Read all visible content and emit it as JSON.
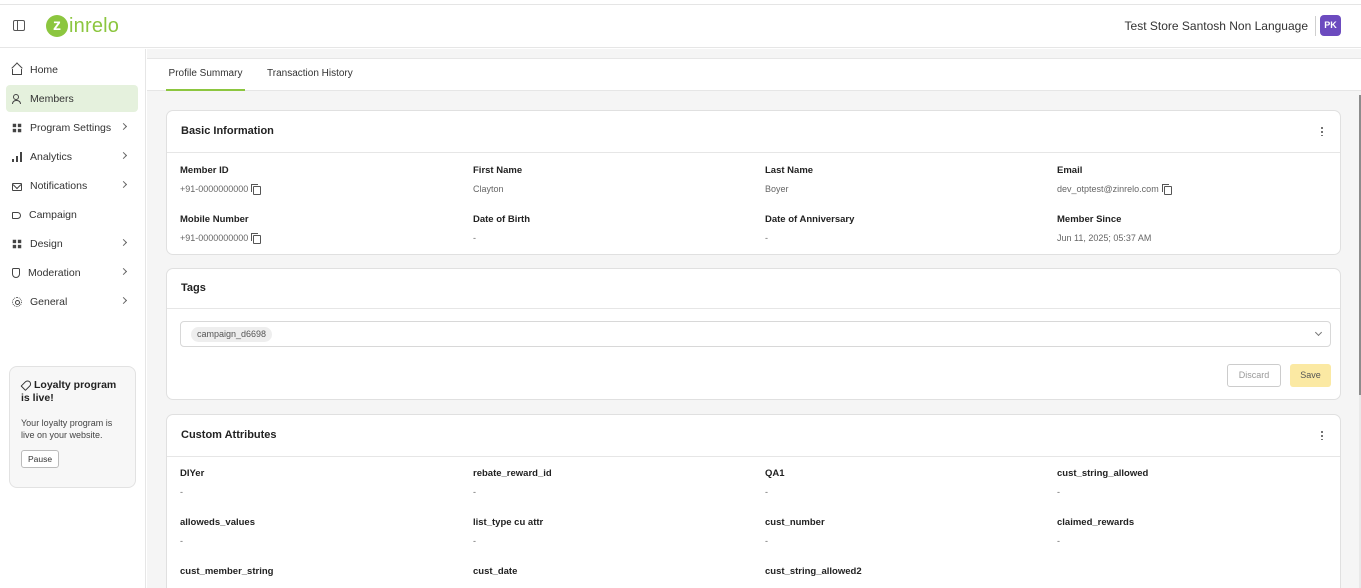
{
  "header": {
    "logo_letter": "z",
    "logo_text": "inrelo",
    "store_name": "Test Store Santosh Non Language",
    "avatar_initials": "PK"
  },
  "sidebar": {
    "items": [
      {
        "label": "Home",
        "icon": "home-icon",
        "has_chevron": false
      },
      {
        "label": "Members",
        "icon": "members-icon",
        "has_chevron": false,
        "active": true
      },
      {
        "label": "Program Settings",
        "icon": "program-settings-icon",
        "has_chevron": true
      },
      {
        "label": "Analytics",
        "icon": "analytics-icon",
        "has_chevron": true
      },
      {
        "label": "Notifications",
        "icon": "mail-icon",
        "has_chevron": true
      },
      {
        "label": "Campaign",
        "icon": "megaphone-icon",
        "has_chevron": false
      },
      {
        "label": "Design",
        "icon": "design-icon",
        "has_chevron": true
      },
      {
        "label": "Moderation",
        "icon": "shield-icon",
        "has_chevron": true
      },
      {
        "label": "General",
        "icon": "gear-icon",
        "has_chevron": true
      }
    ],
    "loyalty": {
      "title": "Loyalty program is live!",
      "text": "Your loyalty program is live on your website.",
      "button": "Pause"
    }
  },
  "tabs": [
    {
      "label": "Profile Summary",
      "active": true
    },
    {
      "label": "Transaction History",
      "active": false
    }
  ],
  "basic_info": {
    "title": "Basic Information",
    "fields": [
      {
        "label": "Member ID",
        "value": "+91-0000000000",
        "copy": true
      },
      {
        "label": "First Name",
        "value": "Clayton"
      },
      {
        "label": "Last Name",
        "value": "Boyer"
      },
      {
        "label": "Email",
        "value": "dev_otptest@zinrelo.com",
        "copy": true
      },
      {
        "label": "Mobile Number",
        "value": "+91-0000000000",
        "copy": true
      },
      {
        "label": "Date of Birth",
        "value": "-"
      },
      {
        "label": "Date of Anniversary",
        "value": "-"
      },
      {
        "label": "Member Since",
        "value": "Jun 11, 2025; 05:37 AM"
      }
    ]
  },
  "tags": {
    "title": "Tags",
    "chips": [
      "campaign_d6698"
    ],
    "discard_label": "Discard",
    "save_label": "Save"
  },
  "custom_attributes": {
    "title": "Custom Attributes",
    "fields": [
      {
        "label": "DIYer",
        "value": "-"
      },
      {
        "label": "rebate_reward_id",
        "value": "-"
      },
      {
        "label": "QA1",
        "value": "-"
      },
      {
        "label": "cust_string_allowed",
        "value": "-"
      },
      {
        "label": "alloweds_values",
        "value": "-"
      },
      {
        "label": "list_type cu attr",
        "value": "-"
      },
      {
        "label": "cust_number",
        "value": "-"
      },
      {
        "label": "claimed_rewards",
        "value": "-"
      },
      {
        "label": "cust_member_string",
        "value": ""
      },
      {
        "label": "cust_date",
        "value": ""
      },
      {
        "label": "cust_string_allowed2",
        "value": ""
      }
    ]
  },
  "colors": {
    "brand": "#8cc63f",
    "active_nav": "#e5f1dd",
    "avatar": "#6c4bbf",
    "save_button": "#fbe9a3"
  }
}
